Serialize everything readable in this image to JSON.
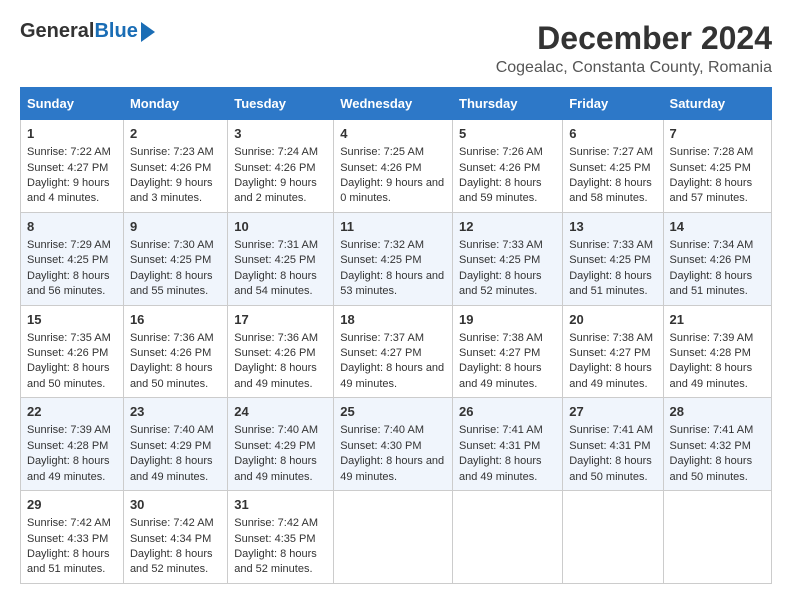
{
  "header": {
    "logo_general": "General",
    "logo_blue": "Blue",
    "main_title": "December 2024",
    "subtitle": "Cogealac, Constanta County, Romania"
  },
  "columns": [
    "Sunday",
    "Monday",
    "Tuesday",
    "Wednesday",
    "Thursday",
    "Friday",
    "Saturday"
  ],
  "weeks": [
    [
      {
        "day": "1",
        "sunrise": "Sunrise: 7:22 AM",
        "sunset": "Sunset: 4:27 PM",
        "daylight": "Daylight: 9 hours and 4 minutes."
      },
      {
        "day": "2",
        "sunrise": "Sunrise: 7:23 AM",
        "sunset": "Sunset: 4:26 PM",
        "daylight": "Daylight: 9 hours and 3 minutes."
      },
      {
        "day": "3",
        "sunrise": "Sunrise: 7:24 AM",
        "sunset": "Sunset: 4:26 PM",
        "daylight": "Daylight: 9 hours and 2 minutes."
      },
      {
        "day": "4",
        "sunrise": "Sunrise: 7:25 AM",
        "sunset": "Sunset: 4:26 PM",
        "daylight": "Daylight: 9 hours and 0 minutes."
      },
      {
        "day": "5",
        "sunrise": "Sunrise: 7:26 AM",
        "sunset": "Sunset: 4:26 PM",
        "daylight": "Daylight: 8 hours and 59 minutes."
      },
      {
        "day": "6",
        "sunrise": "Sunrise: 7:27 AM",
        "sunset": "Sunset: 4:25 PM",
        "daylight": "Daylight: 8 hours and 58 minutes."
      },
      {
        "day": "7",
        "sunrise": "Sunrise: 7:28 AM",
        "sunset": "Sunset: 4:25 PM",
        "daylight": "Daylight: 8 hours and 57 minutes."
      }
    ],
    [
      {
        "day": "8",
        "sunrise": "Sunrise: 7:29 AM",
        "sunset": "Sunset: 4:25 PM",
        "daylight": "Daylight: 8 hours and 56 minutes."
      },
      {
        "day": "9",
        "sunrise": "Sunrise: 7:30 AM",
        "sunset": "Sunset: 4:25 PM",
        "daylight": "Daylight: 8 hours and 55 minutes."
      },
      {
        "day": "10",
        "sunrise": "Sunrise: 7:31 AM",
        "sunset": "Sunset: 4:25 PM",
        "daylight": "Daylight: 8 hours and 54 minutes."
      },
      {
        "day": "11",
        "sunrise": "Sunrise: 7:32 AM",
        "sunset": "Sunset: 4:25 PM",
        "daylight": "Daylight: 8 hours and 53 minutes."
      },
      {
        "day": "12",
        "sunrise": "Sunrise: 7:33 AM",
        "sunset": "Sunset: 4:25 PM",
        "daylight": "Daylight: 8 hours and 52 minutes."
      },
      {
        "day": "13",
        "sunrise": "Sunrise: 7:33 AM",
        "sunset": "Sunset: 4:25 PM",
        "daylight": "Daylight: 8 hours and 51 minutes."
      },
      {
        "day": "14",
        "sunrise": "Sunrise: 7:34 AM",
        "sunset": "Sunset: 4:26 PM",
        "daylight": "Daylight: 8 hours and 51 minutes."
      }
    ],
    [
      {
        "day": "15",
        "sunrise": "Sunrise: 7:35 AM",
        "sunset": "Sunset: 4:26 PM",
        "daylight": "Daylight: 8 hours and 50 minutes."
      },
      {
        "day": "16",
        "sunrise": "Sunrise: 7:36 AM",
        "sunset": "Sunset: 4:26 PM",
        "daylight": "Daylight: 8 hours and 50 minutes."
      },
      {
        "day": "17",
        "sunrise": "Sunrise: 7:36 AM",
        "sunset": "Sunset: 4:26 PM",
        "daylight": "Daylight: 8 hours and 49 minutes."
      },
      {
        "day": "18",
        "sunrise": "Sunrise: 7:37 AM",
        "sunset": "Sunset: 4:27 PM",
        "daylight": "Daylight: 8 hours and 49 minutes."
      },
      {
        "day": "19",
        "sunrise": "Sunrise: 7:38 AM",
        "sunset": "Sunset: 4:27 PM",
        "daylight": "Daylight: 8 hours and 49 minutes."
      },
      {
        "day": "20",
        "sunrise": "Sunrise: 7:38 AM",
        "sunset": "Sunset: 4:27 PM",
        "daylight": "Daylight: 8 hours and 49 minutes."
      },
      {
        "day": "21",
        "sunrise": "Sunrise: 7:39 AM",
        "sunset": "Sunset: 4:28 PM",
        "daylight": "Daylight: 8 hours and 49 minutes."
      }
    ],
    [
      {
        "day": "22",
        "sunrise": "Sunrise: 7:39 AM",
        "sunset": "Sunset: 4:28 PM",
        "daylight": "Daylight: 8 hours and 49 minutes."
      },
      {
        "day": "23",
        "sunrise": "Sunrise: 7:40 AM",
        "sunset": "Sunset: 4:29 PM",
        "daylight": "Daylight: 8 hours and 49 minutes."
      },
      {
        "day": "24",
        "sunrise": "Sunrise: 7:40 AM",
        "sunset": "Sunset: 4:29 PM",
        "daylight": "Daylight: 8 hours and 49 minutes."
      },
      {
        "day": "25",
        "sunrise": "Sunrise: 7:40 AM",
        "sunset": "Sunset: 4:30 PM",
        "daylight": "Daylight: 8 hours and 49 minutes."
      },
      {
        "day": "26",
        "sunrise": "Sunrise: 7:41 AM",
        "sunset": "Sunset: 4:31 PM",
        "daylight": "Daylight: 8 hours and 49 minutes."
      },
      {
        "day": "27",
        "sunrise": "Sunrise: 7:41 AM",
        "sunset": "Sunset: 4:31 PM",
        "daylight": "Daylight: 8 hours and 50 minutes."
      },
      {
        "day": "28",
        "sunrise": "Sunrise: 7:41 AM",
        "sunset": "Sunset: 4:32 PM",
        "daylight": "Daylight: 8 hours and 50 minutes."
      }
    ],
    [
      {
        "day": "29",
        "sunrise": "Sunrise: 7:42 AM",
        "sunset": "Sunset: 4:33 PM",
        "daylight": "Daylight: 8 hours and 51 minutes."
      },
      {
        "day": "30",
        "sunrise": "Sunrise: 7:42 AM",
        "sunset": "Sunset: 4:34 PM",
        "daylight": "Daylight: 8 hours and 52 minutes."
      },
      {
        "day": "31",
        "sunrise": "Sunrise: 7:42 AM",
        "sunset": "Sunset: 4:35 PM",
        "daylight": "Daylight: 8 hours and 52 minutes."
      },
      null,
      null,
      null,
      null
    ]
  ]
}
